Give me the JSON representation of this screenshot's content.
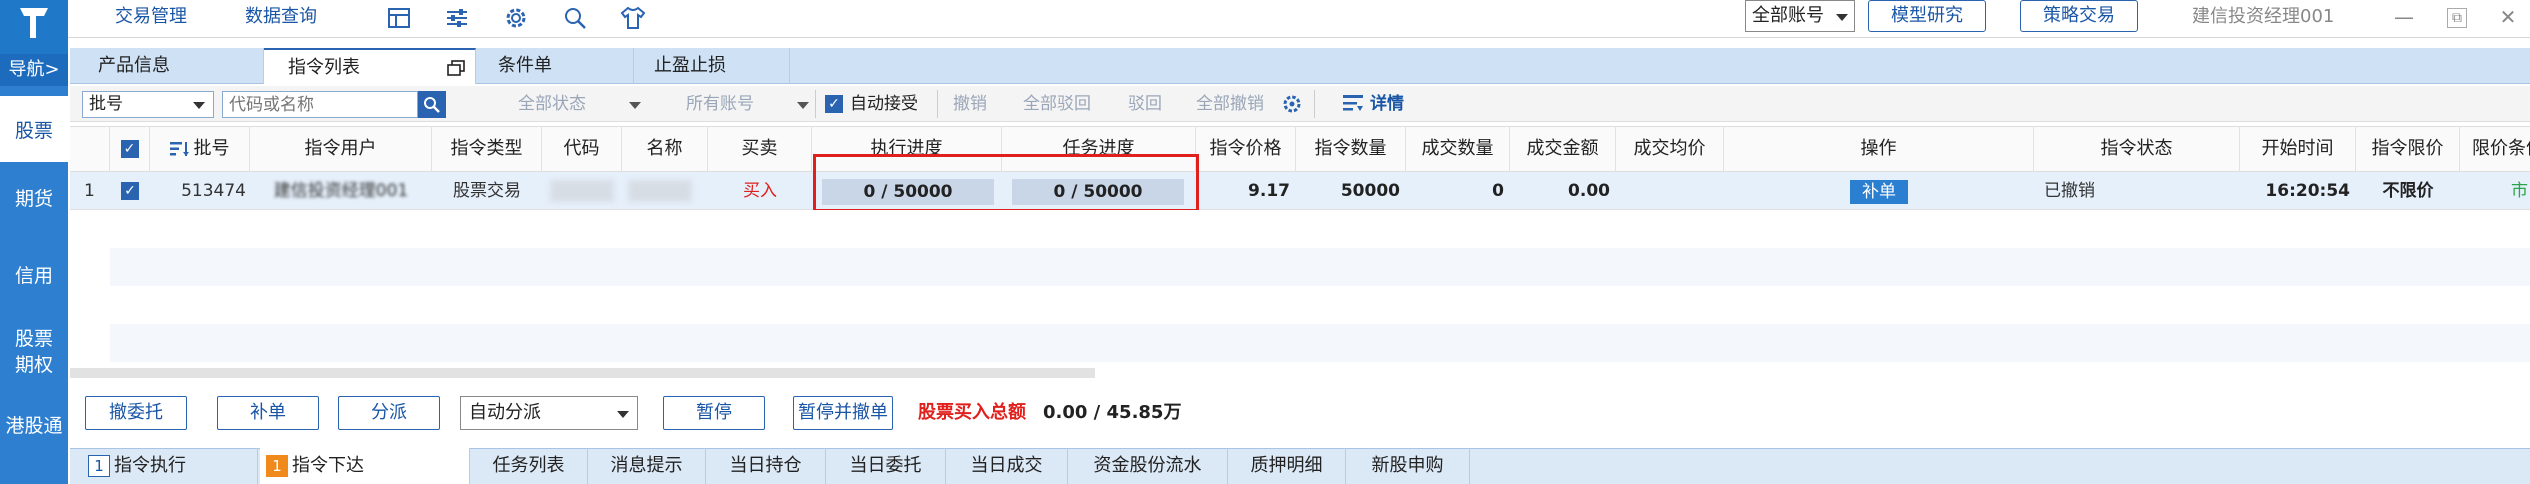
{
  "top": {
    "menu": [
      "交易管理",
      "数据查询"
    ],
    "account_select": "全部账号",
    "model_research": "模型研究",
    "strategy_trading": "策略交易",
    "user": "建信投资经理001"
  },
  "nav": {
    "toggle": "导航>",
    "items": [
      "股票",
      "期货",
      "信用",
      "股票期权",
      "港股通"
    ]
  },
  "tabs": [
    "产品信息",
    "指令列表",
    "条件单",
    "止盈止损"
  ],
  "filter": {
    "batch_select": "批号",
    "code_placeholder": "代码或名称",
    "all_status": "全部状态",
    "all_accounts": "所有账号",
    "auto_accept": "自动接受",
    "revoke": "撤销",
    "revoke_all_reject": "全部驳回",
    "reject": "驳回",
    "revoke_all": "全部撤销",
    "details": "详情"
  },
  "table": {
    "headers": [
      "批号",
      "指令用户",
      "指令类型",
      "代码",
      "名称",
      "买卖",
      "执行进度",
      "任务进度",
      "指令价格",
      "指令数量",
      "成交数量",
      "成交金额",
      "成交均价",
      "操作",
      "指令状态",
      "开始时间",
      "指令限价",
      "限价条件"
    ],
    "rows": [
      {
        "index": "1",
        "batch": "513474",
        "user": "建信投资经理001",
        "type": "股票交易",
        "code": "",
        "name": "",
        "side": "买入",
        "exec_progress": "0 / 50000",
        "task_progress": "0 / 50000",
        "price": "9.17",
        "quantity": "50000",
        "filled_qty": "0",
        "filled_amount": "0.00",
        "avg_price": "",
        "action": "补单",
        "status": "已撤销",
        "start_time": "16:20:54",
        "limit": "不限价",
        "limit_cond": "市"
      }
    ]
  },
  "actions": {
    "withdraw": "撤委托",
    "resubmit": "补单",
    "dispatch": "分派",
    "dispatch_mode": "自动分派",
    "pause": "暂停",
    "pause_withdraw": "暂停并撤单",
    "total_label": "股票买入总额",
    "total_value": "0.00 / 45.85万"
  },
  "bottom_tabs": [
    {
      "num": "1",
      "label": "指令执行"
    },
    {
      "num": "1",
      "label": "指令下达"
    },
    {
      "label": "任务列表"
    },
    {
      "label": "消息提示"
    },
    {
      "label": "当日持仓"
    },
    {
      "label": "当日委托"
    },
    {
      "label": "当日成交"
    },
    {
      "label": "资金股份流水"
    },
    {
      "label": "质押明细"
    },
    {
      "label": "新股申购"
    }
  ],
  "colors": {
    "accent": "#2a64b0",
    "nav": "#2e7fd0",
    "buy": "#e0201c",
    "highlight": "#e0201c"
  }
}
